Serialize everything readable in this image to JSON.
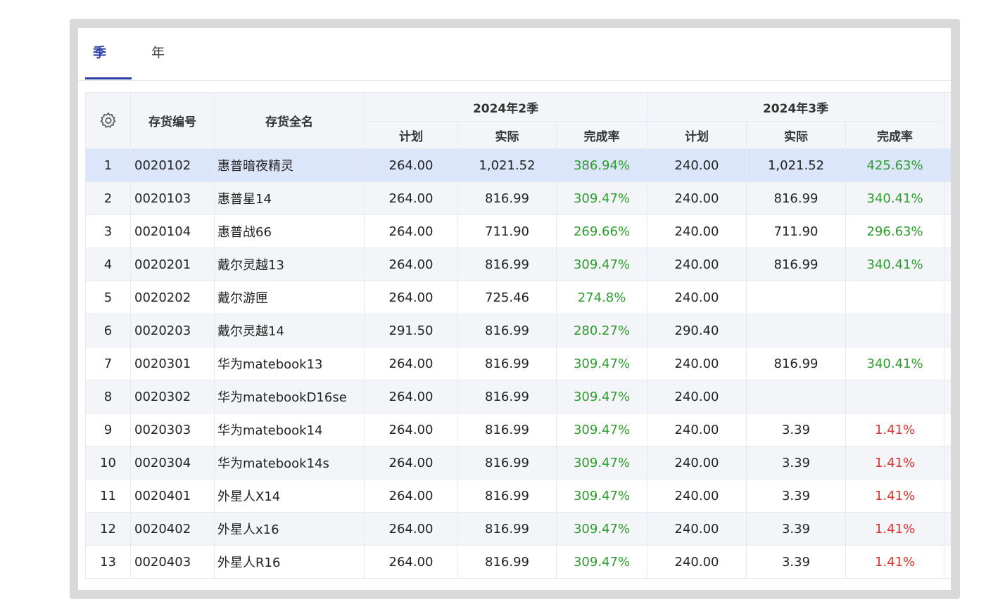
{
  "tabs": [
    {
      "label": "季",
      "active": true
    },
    {
      "label": "年",
      "active": false
    }
  ],
  "table": {
    "settings_icon": "gear-icon",
    "columns": {
      "code": "存货编号",
      "name": "存货全名"
    },
    "periods": [
      {
        "label": "2024年2季",
        "sub": [
          "计划",
          "实际",
          "完成率"
        ]
      },
      {
        "label": "2024年3季",
        "sub": [
          "计划",
          "实际",
          "完成率"
        ]
      }
    ],
    "rows": [
      {
        "idx": "1",
        "code": "0020102",
        "name": "惠普暗夜精灵",
        "q2_plan": "264.00",
        "q2_actual": "1,021.52",
        "q2_rate": "386.94%",
        "q3_plan": "240.00",
        "q3_actual": "1,021.52",
        "q3_rate": "425.63%",
        "q3_rate_status": "green",
        "selected": true
      },
      {
        "idx": "2",
        "code": "0020103",
        "name": "惠普星14",
        "q2_plan": "264.00",
        "q2_actual": "816.99",
        "q2_rate": "309.47%",
        "q3_plan": "240.00",
        "q3_actual": "816.99",
        "q3_rate": "340.41%",
        "q3_rate_status": "green"
      },
      {
        "idx": "3",
        "code": "0020104",
        "name": "惠普战66",
        "q2_plan": "264.00",
        "q2_actual": "711.90",
        "q2_rate": "269.66%",
        "q3_plan": "240.00",
        "q3_actual": "711.90",
        "q3_rate": "296.63%",
        "q3_rate_status": "green"
      },
      {
        "idx": "4",
        "code": "0020201",
        "name": "戴尔灵越13",
        "q2_plan": "264.00",
        "q2_actual": "816.99",
        "q2_rate": "309.47%",
        "q3_plan": "240.00",
        "q3_actual": "816.99",
        "q3_rate": "340.41%",
        "q3_rate_status": "green"
      },
      {
        "idx": "5",
        "code": "0020202",
        "name": "戴尔游匣",
        "q2_plan": "264.00",
        "q2_actual": "725.46",
        "q2_rate": "274.8%",
        "q3_plan": "240.00",
        "q3_actual": "",
        "q3_rate": "",
        "q3_rate_status": "green"
      },
      {
        "idx": "6",
        "code": "0020203",
        "name": "戴尔灵越14",
        "q2_plan": "291.50",
        "q2_actual": "816.99",
        "q2_rate": "280.27%",
        "q3_plan": "290.40",
        "q3_actual": "",
        "q3_rate": "",
        "q3_rate_status": "green"
      },
      {
        "idx": "7",
        "code": "0020301",
        "name": "华为matebook13",
        "q2_plan": "264.00",
        "q2_actual": "816.99",
        "q2_rate": "309.47%",
        "q3_plan": "240.00",
        "q3_actual": "816.99",
        "q3_rate": "340.41%",
        "q3_rate_status": "green"
      },
      {
        "idx": "8",
        "code": "0020302",
        "name": "华为matebookD16se",
        "q2_plan": "264.00",
        "q2_actual": "816.99",
        "q2_rate": "309.47%",
        "q3_plan": "240.00",
        "q3_actual": "",
        "q3_rate": "",
        "q3_rate_status": "green"
      },
      {
        "idx": "9",
        "code": "0020303",
        "name": "华为matebook14",
        "q2_plan": "264.00",
        "q2_actual": "816.99",
        "q2_rate": "309.47%",
        "q3_plan": "240.00",
        "q3_actual": "3.39",
        "q3_rate": "1.41%",
        "q3_rate_status": "red"
      },
      {
        "idx": "10",
        "code": "0020304",
        "name": "华为matebook14s",
        "q2_plan": "264.00",
        "q2_actual": "816.99",
        "q2_rate": "309.47%",
        "q3_plan": "240.00",
        "q3_actual": "3.39",
        "q3_rate": "1.41%",
        "q3_rate_status": "red"
      },
      {
        "idx": "11",
        "code": "0020401",
        "name": "外星人X14",
        "q2_plan": "264.00",
        "q2_actual": "816.99",
        "q2_rate": "309.47%",
        "q3_plan": "240.00",
        "q3_actual": "3.39",
        "q3_rate": "1.41%",
        "q3_rate_status": "red"
      },
      {
        "idx": "12",
        "code": "0020402",
        "name": "外星人x16",
        "q2_plan": "264.00",
        "q2_actual": "816.99",
        "q2_rate": "309.47%",
        "q3_plan": "240.00",
        "q3_actual": "3.39",
        "q3_rate": "1.41%",
        "q3_rate_status": "red"
      },
      {
        "idx": "13",
        "code": "0020403",
        "name": "外星人R16",
        "q2_plan": "264.00",
        "q2_actual": "816.99",
        "q2_rate": "309.47%",
        "q3_plan": "240.00",
        "q3_actual": "3.39",
        "q3_rate": "1.41%",
        "q3_rate_status": "red"
      }
    ]
  },
  "colors": {
    "accent": "#2b3ea8",
    "rate_green": "#2e9b2e",
    "rate_red": "#e03030",
    "header_bg": "#f3f5f9",
    "selected_row_bg": "#dce6fb"
  }
}
